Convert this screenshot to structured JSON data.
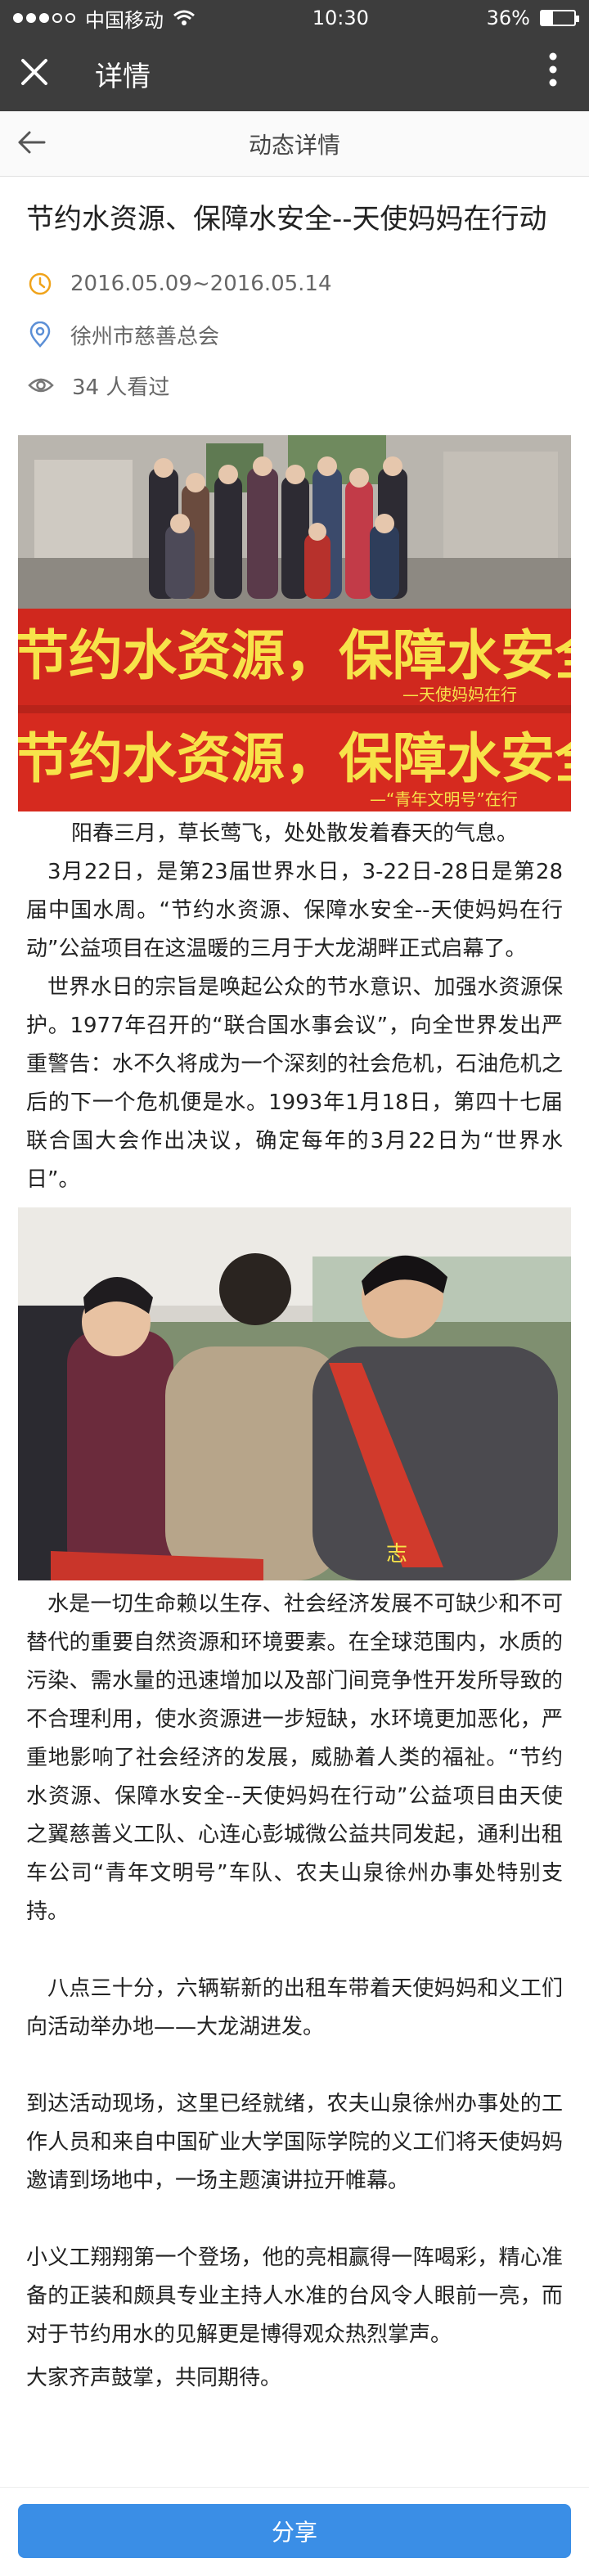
{
  "status_bar": {
    "carrier": "中国移动",
    "time": "10:30",
    "battery_percent": "36%",
    "battery_level": 0.36
  },
  "app_bar": {
    "title": "详情"
  },
  "sub_nav": {
    "title": "动态详情"
  },
  "article": {
    "title": "节约水资源、保障水安全--天使妈妈在行动",
    "date_range": "2016.05.09~2016.05.14",
    "location": "徐州市慈善总会",
    "views": "34 人看过",
    "banner_text_1": "节约水资源，保障水安全",
    "banner_sub_1": "—天使妈妈在行",
    "banner_text_2": "节约水资源，保障水安全",
    "banner_sub_2": "—“青年文明号”在行",
    "sash_text": "志",
    "paragraphs": [
      "阳春三月，草长莺飞，处处散发着春天的气息。",
      "3月22日，是第23届世界水日，3-22日-28日是第28届中国水周。“节约水资源、保障水安全--天使妈妈在行动”公益项目在这温暖的三月于大龙湖畔正式启幕了。",
      "世界水日的宗旨是唤起公众的节水意识、加强水资源保护。1977年召开的“联合国水事会议”，向全世界发出严重警告：水不久将成为一个深刻的社会危机，石油危机之后的下一个危机便是水。1993年1月18日，第四十七届联合国大会作出决议，确定每年的3月22日为“世界水日”。",
      "水是一切生命赖以生存、社会经济发展不可缺少和不可替代的重要自然资源和环境要素。在全球范围内，水质的污染、需水量的迅速增加以及部门间竞争性开发所导致的不合理利用，使水资源进一步短缺，水环境更加恶化，严重地影响了社会经济的发展，威胁着人类的福祉。“节约水资源、保障水安全--天使妈妈在行动”公益项目由天使之翼慈善义工队、心连心彭城微公益共同发起，通利出租车公司“青年文明号”车队、农夫山泉徐州办事处特别支持。",
      "八点三十分，六辆崭新的出租车带着天使妈妈和义工们向活动举办地——大龙湖进发。",
      "到达活动现场，这里已经就绪，农夫山泉徐州办事处的工作人员和来自中国矿业大学国际学院的义工们将天使妈妈邀请到场地中，一场主题演讲拉开帷幕。",
      "小义工翔翔第一个登场，他的亮相赢得一阵喝彩，精心准备的正装和颇具专业主持人水准的台风令人眼前一亮，而对于节约用水的见解更是博得观众热烈掌声。",
      "大家齐声鼓掌，共同期待。"
    ]
  },
  "footer": {
    "share_label": "分享"
  },
  "colors": {
    "bar_bg": "#3d3d3d",
    "accent_blue": "#3a8ee6",
    "banner_red": "#d0281e",
    "banner_text": "#f7e34a"
  },
  "icons": [
    "close-icon",
    "more-vert-icon",
    "back-arrow-icon",
    "clock-icon",
    "location-pin-icon",
    "eye-icon",
    "wifi-icon",
    "signal-dots-icon",
    "battery-icon"
  ]
}
